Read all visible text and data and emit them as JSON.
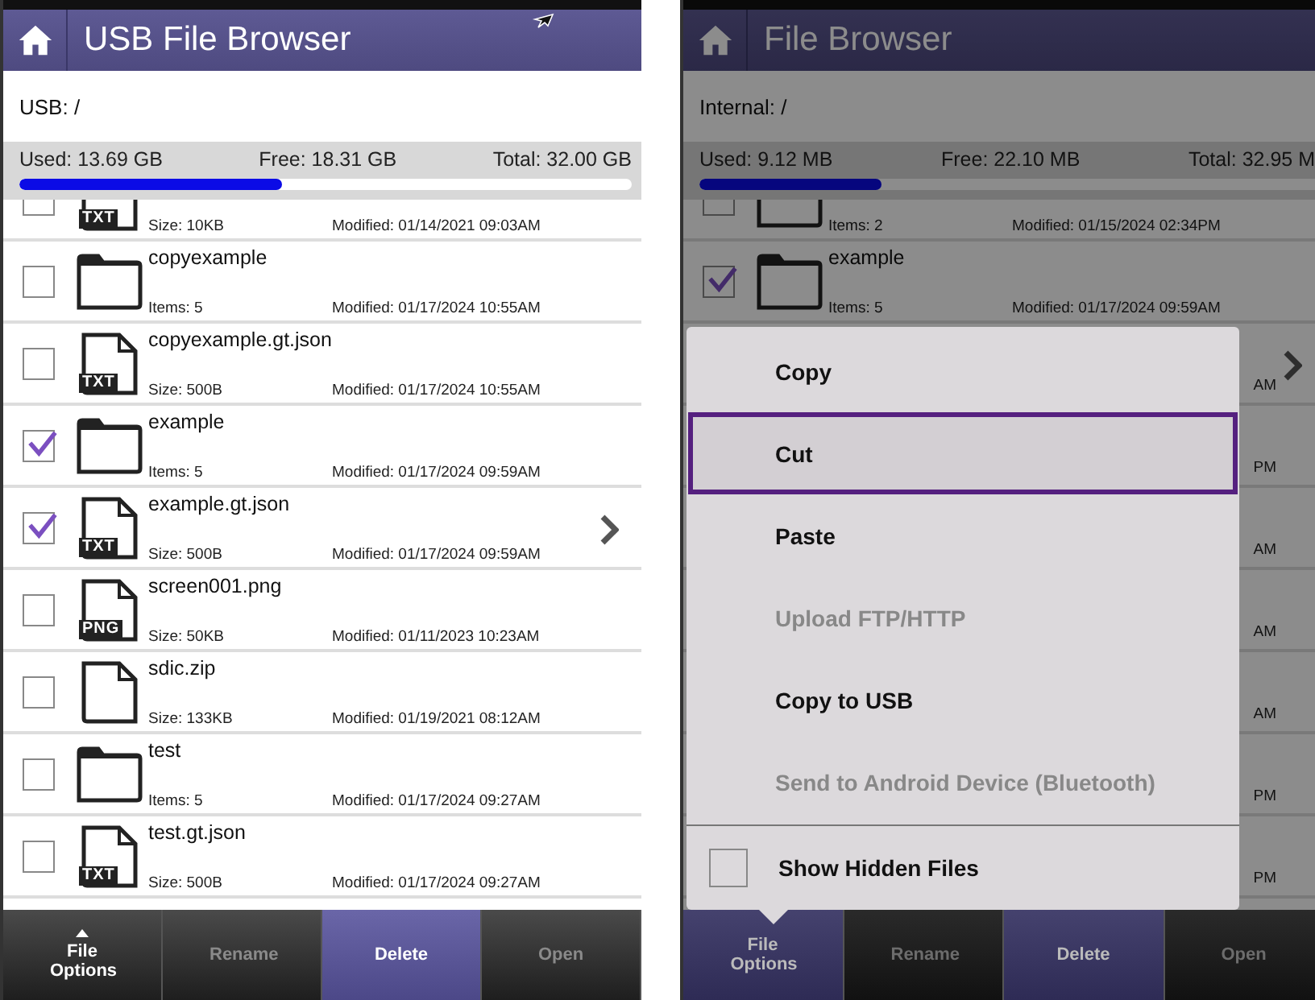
{
  "panels": [
    {
      "title": "USB File Browser",
      "cursor": true,
      "path": "USB: /",
      "storage": {
        "used": "Used: 13.69 GB",
        "free": "Free: 18.31 GB",
        "total": "Total: 32.00 GB",
        "level": 0.43
      },
      "dimmed": false,
      "files": [
        {
          "kind": "document",
          "badge": "TXT",
          "detail": "Size: 10KB",
          "modified": "Modified: 01/14/2021 09:03AM",
          "checked": false,
          "chevron": false
        },
        {
          "kind": "folder",
          "name": "copyexample",
          "detail": "Items: 5",
          "modified": "Modified: 01/17/2024 10:55AM",
          "checked": false,
          "chevron": false
        },
        {
          "kind": "document",
          "badge": "TXT",
          "name": "copyexample.gt.json",
          "detail": "Size: 500B",
          "modified": "Modified: 01/17/2024 10:55AM",
          "checked": false,
          "chevron": false
        },
        {
          "kind": "folder",
          "name": "example",
          "detail": "Items: 5",
          "modified": "Modified: 01/17/2024 09:59AM",
          "checked": true,
          "chevron": false
        },
        {
          "kind": "document",
          "badge": "TXT",
          "name": "example.gt.json",
          "detail": "Size: 500B",
          "modified": "Modified: 01/17/2024 09:59AM",
          "checked": true,
          "chevron": true
        },
        {
          "kind": "document",
          "badge": "PNG",
          "name": "screen001.png",
          "detail": "Size: 50KB",
          "modified": "Modified: 01/11/2023 10:23AM",
          "checked": false,
          "chevron": false
        },
        {
          "kind": "document",
          "name": "sdic.zip",
          "detail": "Size: 133KB",
          "modified": "Modified: 01/19/2021 08:12AM",
          "checked": false,
          "chevron": false
        },
        {
          "kind": "folder",
          "name": "test",
          "detail": "Items: 5",
          "modified": "Modified: 01/17/2024 09:27AM",
          "checked": false,
          "chevron": false
        },
        {
          "kind": "document",
          "badge": "TXT",
          "name": "test.gt.json",
          "detail": "Size: 500B",
          "modified": "Modified: 01/17/2024 09:27AM",
          "checked": false,
          "chevron": false
        }
      ],
      "actions": [
        {
          "label": "File Options",
          "caret": true,
          "selected": false,
          "disabled": false
        },
        {
          "label": "Rename",
          "caret": false,
          "selected": false,
          "disabled": true
        },
        {
          "label": "Delete",
          "caret": false,
          "selected": true,
          "disabled": false
        },
        {
          "label": "Open",
          "caret": false,
          "selected": false,
          "disabled": true
        }
      ]
    },
    {
      "title": "File Browser",
      "cursor": false,
      "path": "Internal: /",
      "storage": {
        "used": "Used: 9.12 MB",
        "free": "Free: 22.10 MB",
        "total": "Total: 32.95 M",
        "level": 0.28
      },
      "dimmed": true,
      "files": [
        {
          "kind": "folder",
          "detail": "Items: 2",
          "modified": "Modified: 01/15/2024 02:34PM",
          "checked": false,
          "chevron": false
        },
        {
          "kind": "folder",
          "name": "example",
          "detail": "Items: 5",
          "modified": "Modified: 01/17/2024 09:59AM",
          "checked": true,
          "chevron": false
        },
        {
          "kind": "covered",
          "tail": "AM",
          "chevron": true
        },
        {
          "kind": "covered",
          "tail": "PM",
          "chevron": false
        },
        {
          "kind": "covered",
          "tail": "AM",
          "chevron": false
        },
        {
          "kind": "covered",
          "tail": "AM",
          "chevron": false
        },
        {
          "kind": "covered",
          "tail": "AM",
          "chevron": false
        },
        {
          "kind": "covered",
          "tail": "PM",
          "chevron": false
        },
        {
          "kind": "covered",
          "tail": "PM",
          "chevron": false
        }
      ],
      "menu": {
        "items": [
          {
            "label": "Copy",
            "selected": false,
            "disabled": false
          },
          {
            "label": "Cut",
            "selected": true,
            "disabled": false
          },
          {
            "label": "Paste",
            "selected": false,
            "disabled": false
          },
          {
            "label": "Upload FTP/HTTP",
            "selected": false,
            "disabled": true
          },
          {
            "label": "Copy to USB",
            "selected": false,
            "disabled": false
          },
          {
            "label": "Send to Android Device (Bluetooth)",
            "selected": false,
            "disabled": true
          }
        ],
        "option": {
          "label": "Show Hidden Files",
          "checked": false
        }
      },
      "actions": [
        {
          "label": "File Options",
          "caret": false,
          "selected": true,
          "disabled": false
        },
        {
          "label": "Rename",
          "caret": false,
          "selected": false,
          "disabled": true
        },
        {
          "label": "Delete",
          "caret": false,
          "selected": true,
          "disabled": false
        },
        {
          "label": "Open",
          "caret": false,
          "selected": false,
          "disabled": true
        }
      ]
    }
  ]
}
